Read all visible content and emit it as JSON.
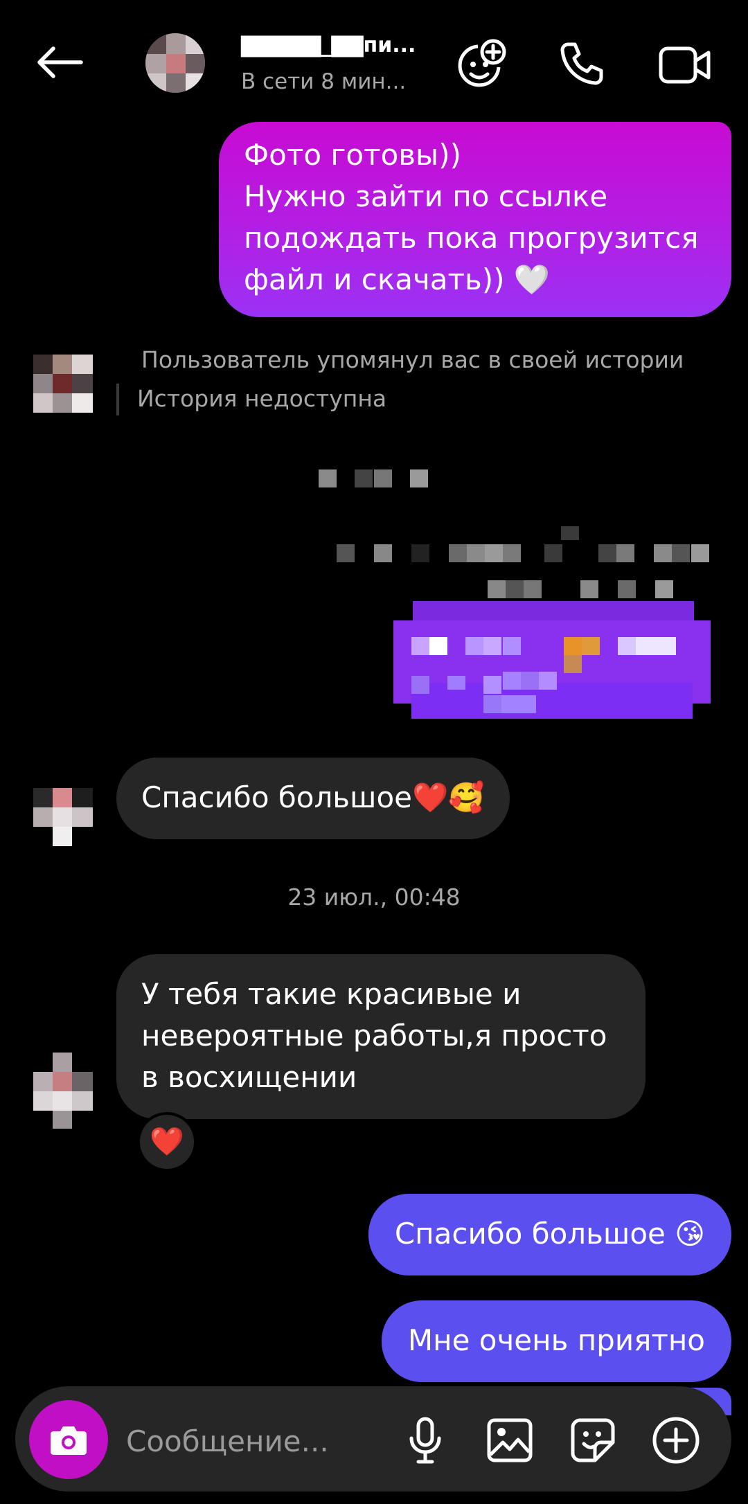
{
  "header": {
    "contact_name": "▇▇▇▇▇_▇▇пи...",
    "status": "В сети 8 мин...",
    "back_icon": "arrow-left-icon",
    "effects_icon": "face-plus-icon",
    "call_icon": "phone-icon",
    "video_icon": "video-camera-icon"
  },
  "messages": {
    "m1_lines": [
      "Фото готовы))",
      "Нужно зайти по ссылке",
      "подождать пока прогрузится",
      "файл и скачать)) 🤍"
    ],
    "story_mention": "Пользователь упомянул вас в своей истории",
    "story_unavailable": "История недоступна",
    "thanks": "Спасибо большое❤️🥰",
    "timestamp": "23 июл., 00:48",
    "compliment_lines": [
      "У тебя такие красивые и",
      "невероятные работы,я просто",
      "в восхищении"
    ],
    "reaction": "❤️",
    "reply1": "Спасибо большое 😘",
    "reply2": "Мне очень приятно"
  },
  "composer": {
    "placeholder": "Сообщение...",
    "camera_icon": "camera-icon",
    "mic_icon": "microphone-icon",
    "gallery_icon": "image-icon",
    "sticker_icon": "sticker-icon",
    "plus_icon": "plus-circle-icon"
  },
  "colors": {
    "background": "#000000",
    "outgoing_gradient_top": "#c80bd2",
    "outgoing_gradient_bottom": "#9a32f4",
    "outgoing_blue": "#5b4ff0",
    "incoming": "#262626",
    "camera_button": "#c00fc4",
    "secondary_text": "#a8a8a8"
  }
}
